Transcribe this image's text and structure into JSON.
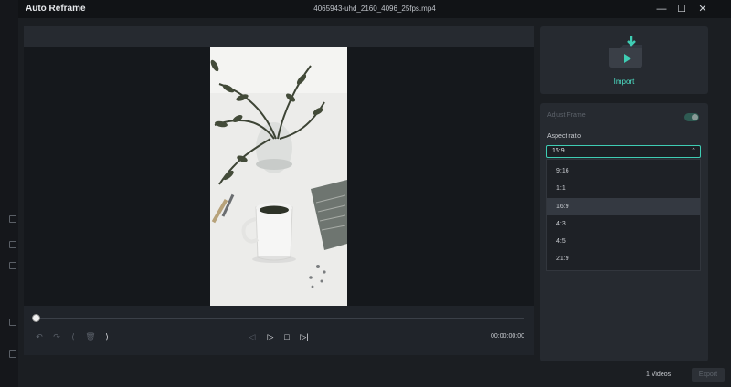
{
  "window": {
    "title": "Auto Reframe",
    "filename": "4065943-uhd_2160_4096_25fps.mp4",
    "minimize_glyph": "—",
    "maximize_glyph": "☐",
    "close_glyph": "✕"
  },
  "player": {
    "timecode": "00:00:00:00",
    "progress": 0,
    "controls": {
      "undo": "↶",
      "redo": "↷",
      "mark_in": "⟨",
      "delete": "🗑",
      "mark_out": "⟩",
      "prev_frame": "◁",
      "play": "▷",
      "stop": "□",
      "next_frame": "▷|"
    }
  },
  "import_panel": {
    "label": "Import"
  },
  "settings": {
    "adjust_frame_label": "Adjust Frame",
    "aspect_ratio_label": "Aspect ratio",
    "selected": "16:9",
    "options": [
      "9:16",
      "1:1",
      "16:9",
      "4:3",
      "4:5",
      "21:9"
    ]
  },
  "footer": {
    "count_label": "1 Videos",
    "export_label": "Export"
  },
  "colors": {
    "accent": "#3fcdb4",
    "accent_text": "#4ee0c6",
    "panel": "#262a30"
  }
}
